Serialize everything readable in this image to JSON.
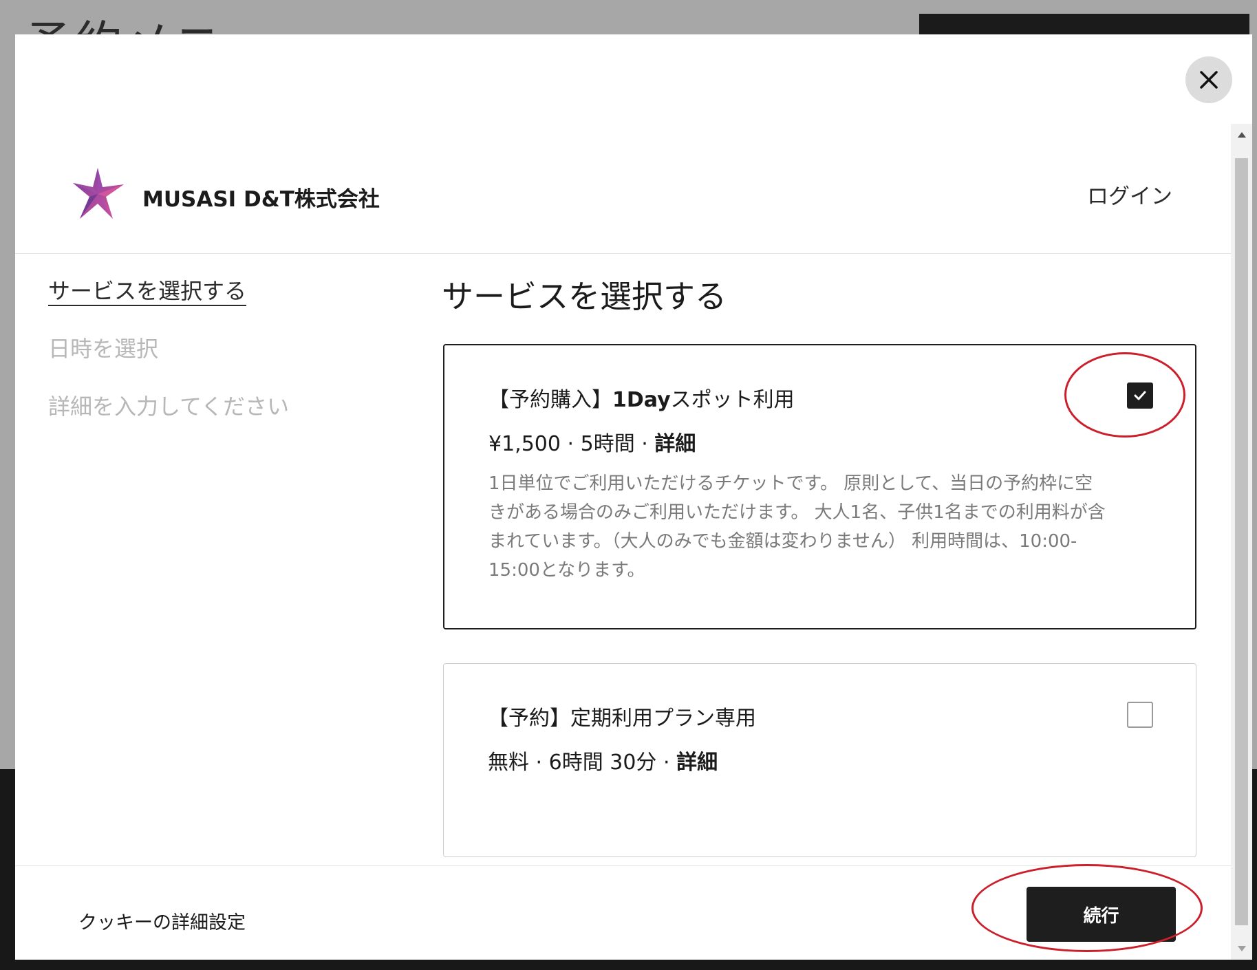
{
  "background": {
    "title": "予約メニュー"
  },
  "header": {
    "company_name": "MUSASI D&T株式会社",
    "login_label": "ログイン"
  },
  "steps": [
    {
      "label": "サービスを選択する",
      "state": "active"
    },
    {
      "label": "日時を選択",
      "state": "inactive"
    },
    {
      "label": "詳細を入力してください",
      "state": "inactive"
    }
  ],
  "main": {
    "title": "サービスを選択する",
    "services": [
      {
        "title_prefix": "【予約購入】",
        "title_bold": "1Day",
        "title_suffix": "スポット利用",
        "price": "¥1,500",
        "duration": "5時間",
        "details_label": "詳細",
        "description": "1日単位でご利用いただけるチケットです。 原則として、当日の予約枠に空きがある場合のみご利用いただけます。 大人1名、子供1名までの利用料が含まれています。（大人のみでも金額は変わりません） 利用時間は、10:00-15:00となります。",
        "selected": true
      },
      {
        "title_prefix": "【予約】定期利用プラン専用",
        "price": "無料",
        "duration": "6時間 30分",
        "details_label": "詳細",
        "selected": false
      }
    ],
    "separator": "·"
  },
  "footer": {
    "cookie_label": "クッキーの詳細設定",
    "continue_label": "続行"
  },
  "colors": {
    "primary": "#1e1e1e",
    "overlay": "#a7a7a7",
    "annotation": "#cc1f2c",
    "logo_start": "#7b3ea8",
    "logo_end": "#e05a9a"
  },
  "icons": {
    "close": "close-icon",
    "check": "check-icon",
    "logo": "star-logo"
  }
}
